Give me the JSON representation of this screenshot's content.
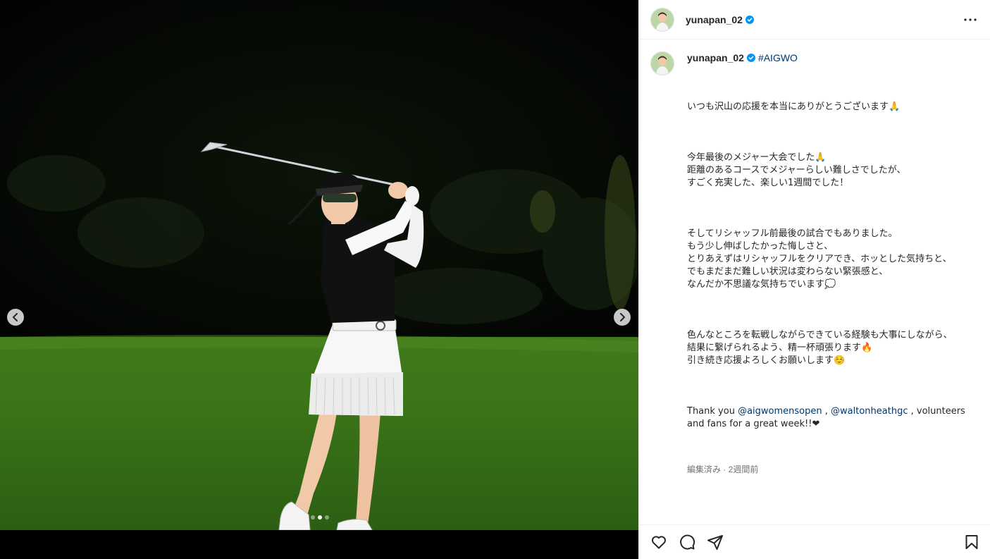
{
  "post": {
    "username": "yunapan_02",
    "hashtag": "#AIGWO",
    "caption_paragraphs": [
      "いつも沢山の応援を本当にありがとうございます🙏",
      "今年最後のメジャー大会でした🙏\n距離のあるコースでメジャーらしい難しさでしたが、\nすごく充実した、楽しい1週間でした！",
      "そしてリシャッフル前最後の試合でもありました。\nもう少し伸ばしたかった悔しさと、\nとりあえずはリシャッフルをクリアでき、ホッとした気持ちと、\nでもまだまだ難しい状況は変わらない緊張感と、\nなんだか不思議な気持ちでいます💭",
      "色んなところを転戦しながらできている経験も大事にしながら、\n結果に繋げられるよう、精一杯頑張ります🔥\n引き続き応援よろしくお願いします☺️"
    ],
    "thanks": {
      "prefix": "Thank you ",
      "mention1": "@aigwomensopen",
      "sep": " , ",
      "mention2": "@waltonheathgc",
      "suffix": " , volunteers and fans for a great week!!❤"
    },
    "meta": "編集済み · 2週間前"
  },
  "media": {
    "dot_count": 3,
    "active_dot": 1
  },
  "icons": {
    "verified": "verified-badge-icon",
    "more": "more-options-icon",
    "prev": "chevron-left-icon",
    "next": "chevron-right-icon",
    "like": "heart-icon",
    "comment": "comment-icon",
    "share": "share-icon",
    "save": "bookmark-icon"
  },
  "colors": {
    "verified": "#0095f6",
    "link": "#00376b",
    "meta": "#737373",
    "text": "#262626"
  }
}
